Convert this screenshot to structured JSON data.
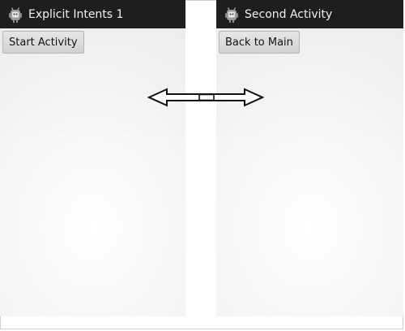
{
  "left_screen": {
    "title": "Explicit Intents 1",
    "button_label": "Start Activity",
    "icon": "android-app-icon"
  },
  "right_screen": {
    "title": "Second Activity",
    "button_label": "Back to Main",
    "icon": "android-app-icon"
  },
  "connector": {
    "icon": "double-headed-arrow-icon"
  },
  "colors": {
    "titlebar": "#1e1e1e",
    "title_text": "#f2f2f2",
    "button_bg": "#dcdcdc"
  }
}
